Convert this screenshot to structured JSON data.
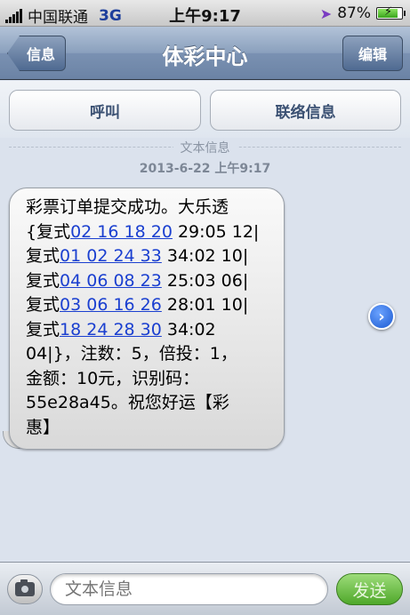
{
  "status_bar": {
    "carrier": "中国联通",
    "network": "3G",
    "time": "上午9:17",
    "battery": "87%",
    "battery_level": 0.87
  },
  "nav": {
    "back_label": "信息",
    "title": "体彩中心",
    "edit_label": "编辑"
  },
  "actions": {
    "call_label": "呼叫",
    "contact_label": "联络信息"
  },
  "thread": {
    "divider_label": "文本信息",
    "timestamp": "2013-6-22 上午9:17"
  },
  "message": {
    "line1": "彩票订单提交成功。大乐透",
    "l2_pre": "{复式",
    "l2_link": "02 16 18 20",
    "l2_post": " 29:05 12|",
    "l3_pre": "复式",
    "l3_link": "01 02 24 33",
    "l3_post": " 34:02 10|",
    "l4_pre": "复式",
    "l4_link": "04 06 08 23",
    "l4_post": " 25:03 06|",
    "l5_pre": "复式",
    "l5_link": "03 06 16 26",
    "l5_post": " 28:01 10|",
    "l6_pre": "复式",
    "l6_link": "18 24 28 30",
    "l6_post": " 34:02",
    "line7": "04|}，注数：5，倍投：1，",
    "line8": "金额：10元，识别码：",
    "line9": "55e28a45。祝您好运【彩",
    "line10": "惠】"
  },
  "compose": {
    "placeholder": "文本信息",
    "send_label": "发送"
  }
}
